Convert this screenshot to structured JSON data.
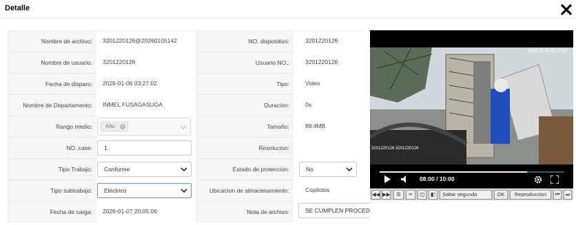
{
  "dialog": {
    "title": "Detalle",
    "close_icon": "close-x-icon"
  },
  "fields": {
    "nombre_archivo": {
      "label": "Nombre de archivo:",
      "value": "3201220126@20260105142"
    },
    "no_dispositivo": {
      "label": "NO. dispositivo:",
      "value": "3201220126"
    },
    "nombre_usuario": {
      "label": "Nombre de usuario:",
      "value": "3201220126"
    },
    "usuario_no": {
      "label": "Usuario NO.:",
      "value": "3201220126"
    },
    "fecha_disparo": {
      "label": "Fecha de disparo:",
      "value": "2026-01-06 03:27:02"
    },
    "tipo": {
      "label": "Tipo:",
      "value": "Video"
    },
    "departamento": {
      "label": "Nombre de Departamento:",
      "value": "INMEL FUSAGASUGA"
    },
    "duracion": {
      "label": "Duracion:",
      "value": "0s"
    },
    "rango_medio": {
      "label": "Rango medio:",
      "tag": "Alto"
    },
    "tamano": {
      "label": "Tamaño:",
      "value": "88.4MB"
    },
    "no_case": {
      "label": "NO. case:",
      "value": "1"
    },
    "resolucion": {
      "label": "Resolucion:",
      "value": ""
    },
    "tipo_trabajo": {
      "label": "Tipo Trabajo:",
      "value": "Conforme"
    },
    "estado_proteccion": {
      "label": "Estado de proteccion:",
      "value": "No"
    },
    "tipo_subtrabajo": {
      "label": "Tipo subtrabajo:",
      "value": "Eléctrico"
    },
    "ubicacion": {
      "label": "Ubicacion de almacenamiento:",
      "value": "Copilotos"
    },
    "fecha_carga": {
      "label": "Fecha de carga:",
      "value": "2026-01-07 20:05:06"
    },
    "nota_archivo": {
      "label": "Nota de archivo:",
      "value": "SE CUMPLEN PROCEDIMIENTOS ELÉCTRICOS - diego ortega"
    }
  },
  "player": {
    "time": "08:00 / 10:00",
    "progress": 0.8,
    "colors": {
      "sky": "#cfd8dc",
      "wall": "#b9b2a6",
      "vest": "#1f4fbf",
      "cabinet": "#d9d9d9"
    }
  },
  "toolbar": {
    "rewind_icon": "rewind-icon",
    "forward_icon": "fast-forward-icon",
    "list_icon": "list-icon",
    "cut_icon": "scissors-icon",
    "clip_icon": "clip-icon",
    "frame_icon": "frame-icon",
    "skip_label": "Saltar segundo",
    "ok_label": "OK",
    "playback_label": "Reproduccion",
    "prev_icon": "step-back-icon",
    "next_icon": "step-forward-icon"
  }
}
